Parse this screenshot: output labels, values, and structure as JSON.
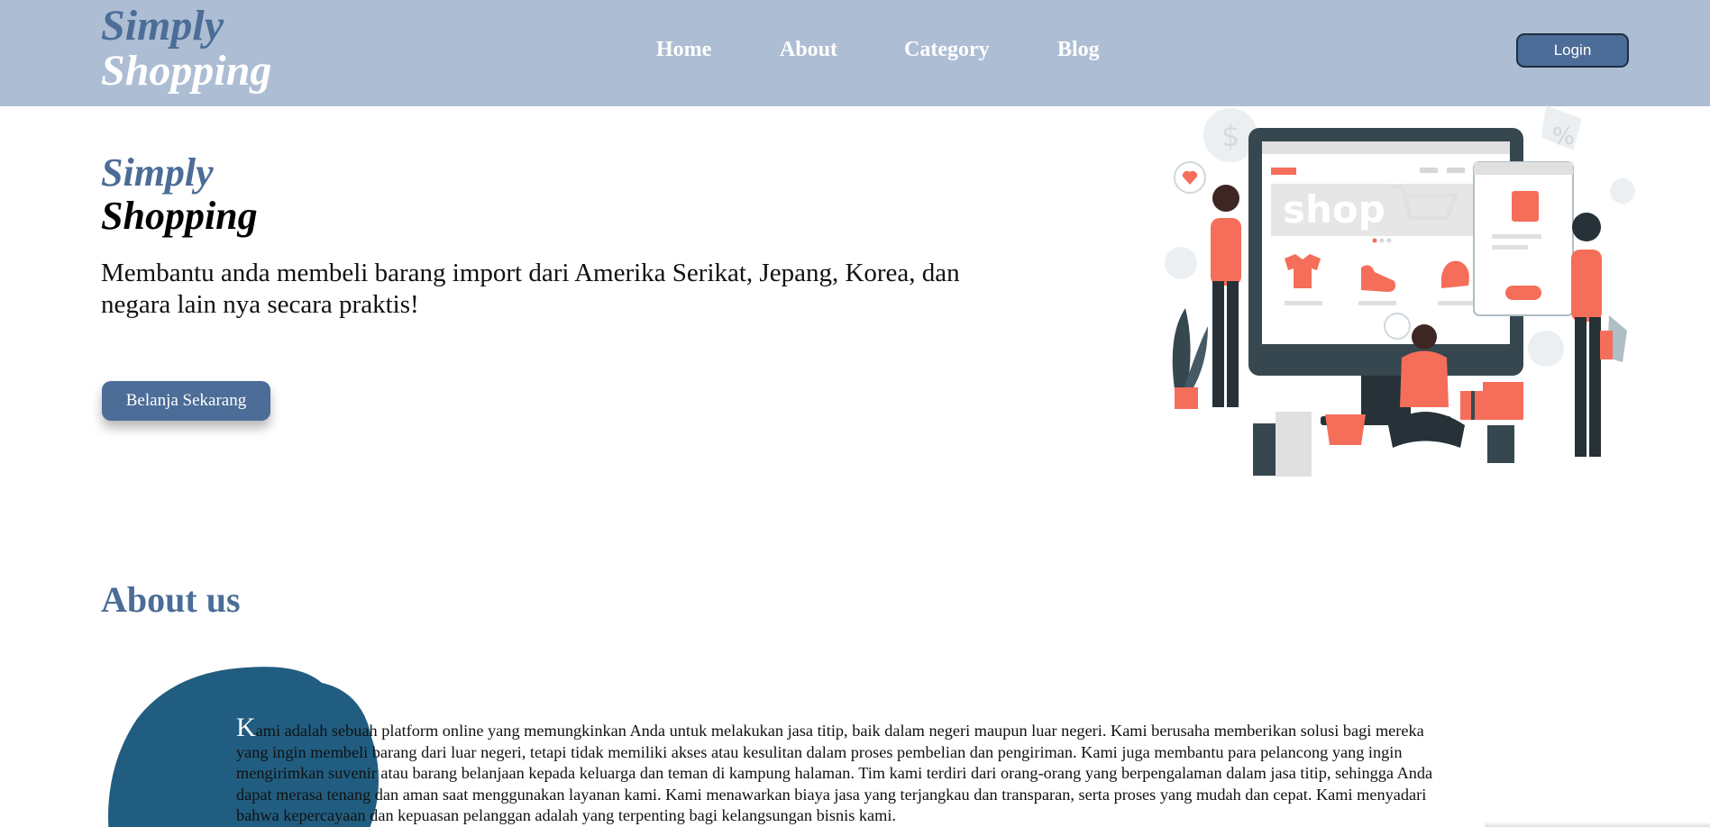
{
  "header": {
    "logo": {
      "line1": "Simply",
      "line2": "Shopping"
    },
    "nav": [
      "Home",
      "About",
      "Category",
      "Blog"
    ],
    "login_label": "Login"
  },
  "hero": {
    "title_line1": "Simply",
    "title_line2": "Shopping",
    "description": "Membantu anda membeli barang import dari Amerika Serikat, Jepang, Korea, dan negara lain nya secara praktis!",
    "cta_label": "Belanja Sekarang",
    "illustration": {
      "screen_text": "shop",
      "sign_text": "%"
    }
  },
  "about": {
    "title": "About us",
    "first_letter": "K",
    "body": "ami adalah sebuah platform online yang memungkinkan Anda untuk melakukan jasa titip, baik dalam negeri maupun luar negeri. Kami berusaha memberikan solusi bagi mereka yang ingin membeli barang dari luar negeri, tetapi tidak memiliki akses atau kesulitan dalam proses pembelian dan pengiriman. Kami juga membantu para pelancong yang ingin mengirimkan suvenir atau barang belanjaan kepada keluarga dan teman di kampung halaman. Tim kami terdiri dari orang-orang yang berpengalaman dalam jasa titip, sehingga Anda dapat merasa tenang dan aman saat menggunakan layanan kami. Kami menawarkan biaya jasa yang terjangkau dan transparan, serta proses yang mudah dan cepat. Kami menyadari bahwa kepercayaan dan kepuasan pelanggan adalah yang terpenting bagi kelangsungan bisnis kami."
  },
  "colors": {
    "header_bg": "#adbdd3",
    "brand_blue": "#4b6d97",
    "blob_blue": "#215d80",
    "accent_coral": "#f56e5a",
    "dark_slate": "#37474f"
  }
}
